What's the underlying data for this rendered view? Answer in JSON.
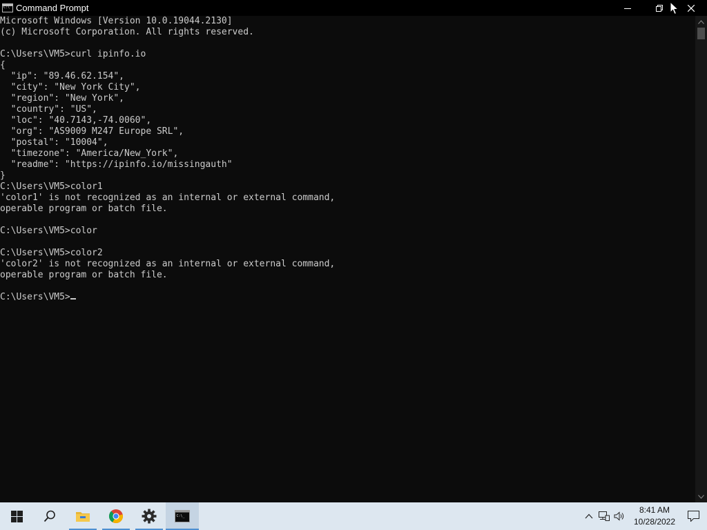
{
  "window": {
    "title": "Command Prompt",
    "controls": [
      "minimize-icon",
      "restore-icon",
      "close-icon"
    ]
  },
  "console": {
    "lines": [
      "Microsoft Windows [Version 10.0.19044.2130]",
      "(c) Microsoft Corporation. All rights reserved.",
      "",
      "C:\\Users\\VM5>curl ipinfo.io",
      "{",
      "  \"ip\": \"89.46.62.154\",",
      "  \"city\": \"New York City\",",
      "  \"region\": \"New York\",",
      "  \"country\": \"US\",",
      "  \"loc\": \"40.7143,-74.0060\",",
      "  \"org\": \"AS9009 M247 Europe SRL\",",
      "  \"postal\": \"10004\",",
      "  \"timezone\": \"America/New_York\",",
      "  \"readme\": \"https://ipinfo.io/missingauth\"",
      "}",
      "C:\\Users\\VM5>color1",
      "'color1' is not recognized as an internal or external command,",
      "operable program or batch file.",
      "",
      "C:\\Users\\VM5>color",
      "",
      "C:\\Users\\VM5>color2",
      "'color2' is not recognized as an internal or external command,",
      "operable program or batch file.",
      ""
    ],
    "prompt": "C:\\Users\\VM5>",
    "text_color": "#cccccc",
    "background": "#0c0c0c"
  },
  "taskbar": {
    "items": [
      {
        "icon": "windows-start-icon"
      },
      {
        "icon": "search-icon"
      },
      {
        "icon": "file-explorer-icon"
      },
      {
        "icon": "chrome-icon"
      },
      {
        "icon": "settings-gear-icon"
      },
      {
        "icon": "command-prompt-icon",
        "active": true
      }
    ],
    "tray": {
      "icons": [
        "chevron-up-icon",
        "network-icon",
        "volume-icon"
      ],
      "time": "8:41 AM",
      "date": "10/28/2022"
    },
    "accent": "#4d8fd1"
  }
}
